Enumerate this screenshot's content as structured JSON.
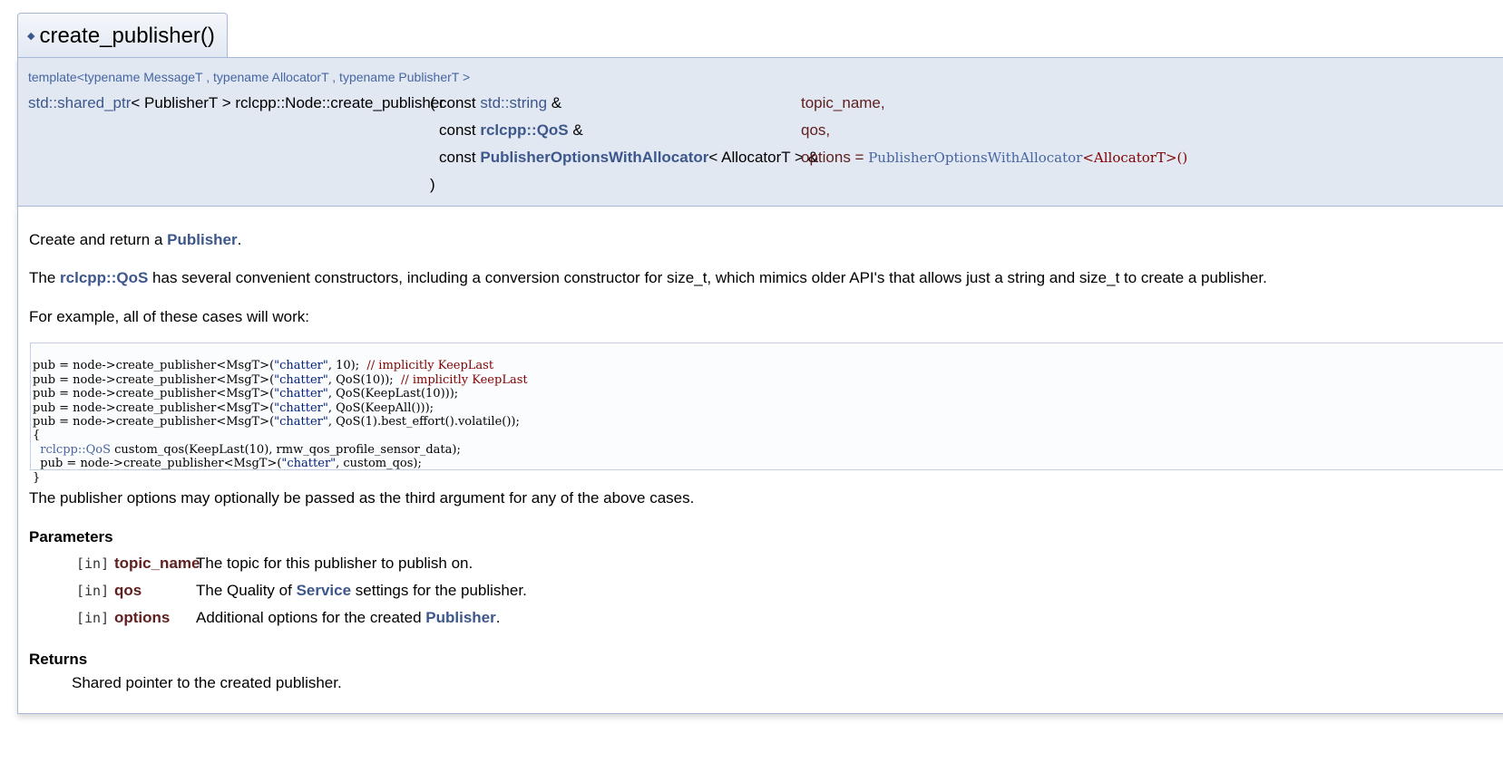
{
  "header": {
    "title": "create_publisher()",
    "diamond": "◆"
  },
  "prototype": {
    "template": "template<typename MessageT , typename AllocatorT , typename PublisherT >",
    "return_prefix": "std::shared_ptr",
    "return_suffix": "< PublisherT > rclcpp::Node::create_publisher",
    "open_paren": "(",
    "args": [
      {
        "pre": "const ",
        "type": "std::string",
        "post": " &",
        "name": "topic_name,"
      },
      {
        "pre": "const ",
        "type": "rclcpp::QoS",
        "post": " &",
        "name": "qos,"
      },
      {
        "pre": "const ",
        "type": "PublisherOptionsWithAllocator",
        "post": "< AllocatorT > &",
        "name": "options",
        "default_eq": " = ",
        "default_type": "PublisherOptionsWithAllocator",
        "default_rest": "<AllocatorT>()"
      }
    ],
    "close_paren": ")"
  },
  "body": {
    "p1_pre": "Create and return a ",
    "p1_link": "Publisher",
    "p1_post": ".",
    "p2_pre": "The ",
    "p2_link": "rclcpp::QoS",
    "p2_post": " has several convenient constructors, including a conversion constructor for size_t, which mimics older API's that allows just a string and size_t to create a publisher.",
    "p3": "For example, all of these cases will work:",
    "code": {
      "l1a": "pub = node->create_publisher<MsgT>(",
      "l1s": "\"chatter\"",
      "l1b": ", 10);  ",
      "l1c": "// implicitly KeepLast",
      "l2a": "pub = node->create_publisher<MsgT>(",
      "l2s": "\"chatter\"",
      "l2b": ", QoS(10));  ",
      "l2c": "// implicitly KeepLast",
      "l3a": "pub = node->create_publisher<MsgT>(",
      "l3s": "\"chatter\"",
      "l3b": ", QoS(KeepLast(10)));",
      "l4a": "pub = node->create_publisher<MsgT>(",
      "l4s": "\"chatter\"",
      "l4b": ", QoS(KeepAll()));",
      "l5a": "pub = node->create_publisher<MsgT>(",
      "l5s": "\"chatter\"",
      "l5b": ", QoS(1).best_effort().volatile());",
      "l6": "{",
      "l7a": "  ",
      "l7t": "rclcpp::QoS",
      "l7b": " custom_qos(KeepLast(10), rmw_qos_profile_sensor_data);",
      "l8a": "  pub = node->create_publisher<MsgT>(",
      "l8s": "\"chatter\"",
      "l8b": ", custom_qos);",
      "l9": "}"
    },
    "p4": "The publisher options may optionally be passed as the third argument for any of the above cases."
  },
  "params": {
    "heading": "Parameters",
    "items": [
      {
        "dir": "[in]",
        "name": "topic_name",
        "desc_pre": "The topic for this publisher to publish on.",
        "link": "",
        "desc_post": ""
      },
      {
        "dir": "[in]",
        "name": "qos",
        "desc_pre": "The Quality of ",
        "link": "Service",
        "desc_post": " settings for the publisher."
      },
      {
        "dir": "[in]",
        "name": "options",
        "desc_pre": "Additional options for the created ",
        "link": "Publisher",
        "desc_post": "."
      }
    ]
  },
  "returns": {
    "heading": "Returns",
    "text": "Shared pointer to the created publisher."
  }
}
